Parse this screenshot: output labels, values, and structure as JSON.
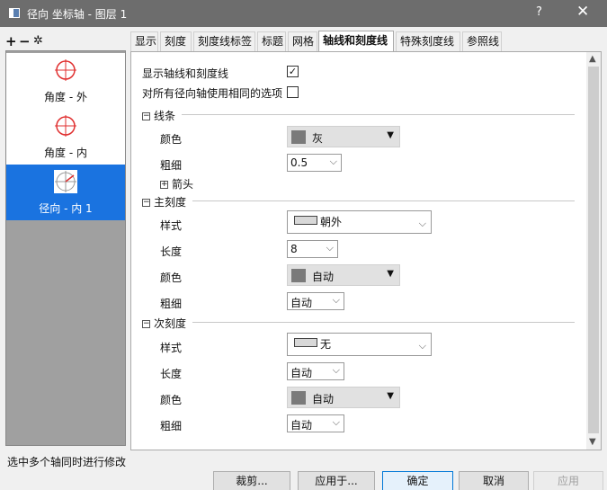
{
  "window": {
    "title": "径向 坐标轴 - 图层 1",
    "help": "?",
    "close": "✕"
  },
  "toolbar": {
    "add": "+",
    "remove": "−",
    "settings": "✲"
  },
  "axes_list": [
    {
      "label": "角度 - 外"
    },
    {
      "label": "角度 - 内"
    },
    {
      "label": "径向 - 内 1"
    }
  ],
  "tabs": [
    "显示",
    "刻度",
    "刻度线标签",
    "标题",
    "网格",
    "轴线和刻度线",
    "特殊刻度线",
    "参照线"
  ],
  "active_tab": "轴线和刻度线",
  "options": {
    "show_axis_ticks": "显示轴线和刻度线",
    "same_all_radial": "对所有径向轴使用相同的选项"
  },
  "line": {
    "section": "线条",
    "color_label": "颜色",
    "color_value": "灰",
    "thickness_label": "粗细",
    "thickness_value": "0.5",
    "arrow": "箭头"
  },
  "major": {
    "section": "主刻度",
    "style_label": "样式",
    "style_value": "朝外",
    "length_label": "长度",
    "length_value": "8",
    "color_label": "颜色",
    "color_value": "自动",
    "thickness_label": "粗细",
    "thickness_value": "自动"
  },
  "minor": {
    "section": "次刻度",
    "style_label": "样式",
    "style_value": "无",
    "length_label": "长度",
    "length_value": "自动",
    "color_label": "颜色",
    "color_value": "自动",
    "thickness_label": "粗细",
    "thickness_value": "自动"
  },
  "status": "选中多个轴同时进行修改",
  "buttons": {
    "clip": "裁剪...",
    "apply_to": "应用于...",
    "ok": "确定",
    "cancel": "取消",
    "apply": "应用"
  },
  "colors": {
    "selected": "#1a73e0",
    "titlebar": "#6d6d6d"
  }
}
